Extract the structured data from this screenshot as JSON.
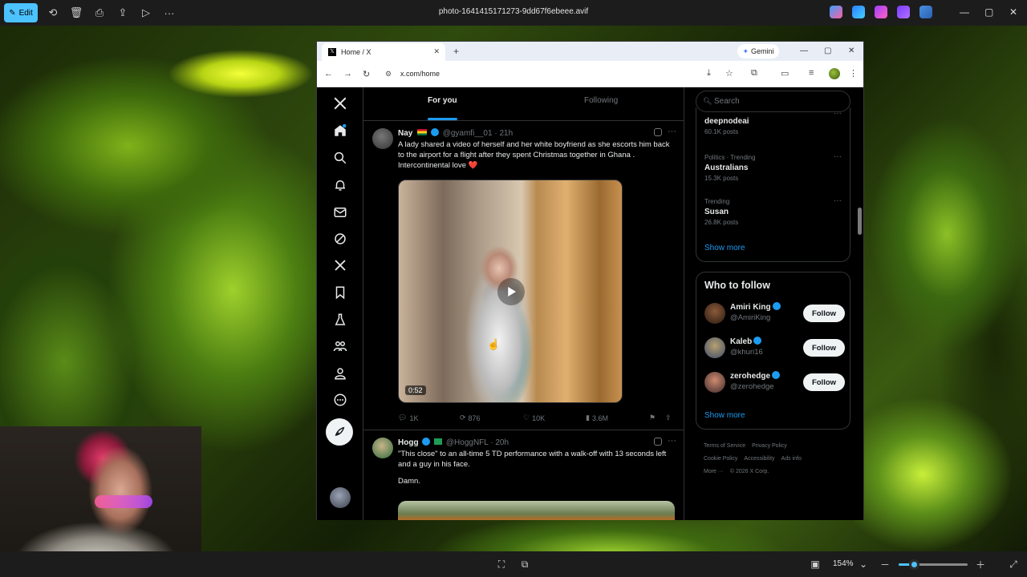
{
  "app": {
    "edit_label": "Edit",
    "filename": "photo-1641415171273-9dd67f6ebeee.avif",
    "zoom": "154%"
  },
  "browser": {
    "tab_title": "Home / X",
    "url": "x.com/home",
    "gemini_label": "Gemini"
  },
  "feed": {
    "tabs": [
      {
        "label": "For you",
        "active": true
      },
      {
        "label": "Following",
        "active": false
      }
    ],
    "tweets": [
      {
        "name": "Nay",
        "handle": "@gyamfi__01",
        "time": "· 21h",
        "text": "A lady shared a video of herself and her white boyfriend as she escorts him back to the airport for a flight after they spent Christmas together in Ghana . Intercontinental love ❤️",
        "video_duration": "0:52",
        "replies": "1K",
        "reposts": "876",
        "likes": "10K",
        "views": "3.6M"
      },
      {
        "name": "Hogg",
        "handle": "@HoggNFL",
        "time": "· 20h",
        "text": "\"This close\" to an all-time 5 TD performance with a walk-off with 13 seconds left and a guy in his face.",
        "text2": "Damn."
      }
    ]
  },
  "sidebar": {
    "search_placeholder": "Search",
    "trends": [
      {
        "category": "",
        "title": "deepnodeai",
        "posts": "60.1K posts"
      },
      {
        "category": "Politics · Trending",
        "title": "Australians",
        "posts": "15.3K posts"
      },
      {
        "category": "Trending",
        "title": "Susan",
        "posts": "26.8K posts"
      }
    ],
    "trends_show_more": "Show more",
    "who_to_follow_title": "Who to follow",
    "follow_suggestions": [
      {
        "name": "Amiri King",
        "handle": "@AmiriKing",
        "button": "Follow"
      },
      {
        "name": "Kaleb",
        "handle": "@khuri16",
        "button": "Follow"
      },
      {
        "name": "zerohedge",
        "handle": "@zerohedge",
        "button": "Follow"
      }
    ],
    "follow_show_more": "Show more",
    "footer_links": [
      "Terms of Service",
      "Privacy Policy",
      "Cookie Policy",
      "Accessibility",
      "Ads info",
      "More ···",
      "© 2026 X Corp."
    ]
  },
  "colors": {
    "accent": "#1d9bf0",
    "edit_button": "#4cc2ff",
    "background": "#000000"
  }
}
